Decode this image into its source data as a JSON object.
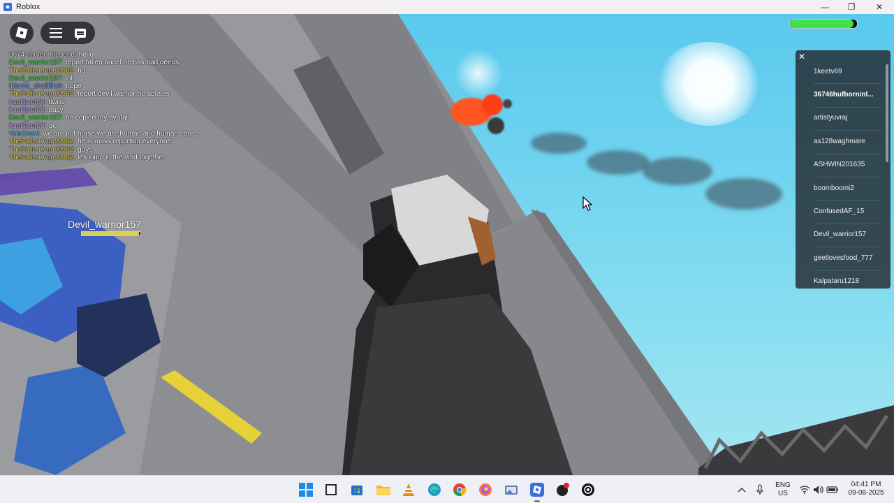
{
  "window": {
    "title": "Roblox",
    "icon": "roblox-icon",
    "controls": [
      "minimize",
      "restore",
      "close"
    ]
  },
  "hud": {
    "health_fraction": 0.95,
    "health_color": "#44e04a",
    "nametag": {
      "name": "Devil_warrior157",
      "health_fraction": 0.98
    }
  },
  "chat": {
    "lines": [
      {
        "user": "3674sfhufbornlegend:",
        "text": "hello",
        "color": "#d8d8d8"
      },
      {
        "user": "Devil_warrior157:",
        "text": "report fallen angel he has bad deeds",
        "color": "#4ee04e"
      },
      {
        "user": "TheFallenAngel0982:",
        "text": "no",
        "color": "#e0d060"
      },
      {
        "user": "Devil_warrior157:",
        "text": "lol",
        "color": "#4ee04e"
      },
      {
        "user": "iblame_shalllllluh:",
        "text": "nope",
        "color": "#6ea8ff"
      },
      {
        "user": "TheFallenAngel0982:",
        "text": "report devil warrior he abuses",
        "color": "#e0d060"
      },
      {
        "user": "kautilya408:",
        "text": "tiwns",
        "color": "#c9a3ff"
      },
      {
        "user": "kautilya408:",
        "text": "easy",
        "color": "#c9a3ff"
      },
      {
        "user": "Devil_warrior157:",
        "text": "he copied my avatar",
        "color": "#4ee04e"
      },
      {
        "user": "kautilya408:",
        "text": "ok",
        "color": "#c9a3ff"
      },
      {
        "user": "Vaishnavi:",
        "text": "we are not horse we are human and humans are...",
        "color": "#5fc0ff"
      },
      {
        "user": "TheFallenAngel0982:",
        "text": "he is mass reporting everyone",
        "color": "#e0d060"
      },
      {
        "user": "TheFallenAngel0982:",
        "text": "guys",
        "color": "#e0d060"
      },
      {
        "user": "TheFallenAngel0982:",
        "text": "les jump in the void together",
        "color": "#e0d060"
      }
    ]
  },
  "player_list": {
    "players": [
      {
        "name": "1keetv69",
        "bold": false
      },
      {
        "name": "36746hufborninl...",
        "bold": true
      },
      {
        "name": "artistyuvraj",
        "bold": false
      },
      {
        "name": "as128waghmare",
        "bold": false
      },
      {
        "name": "ASHWIN201635",
        "bold": false
      },
      {
        "name": "boomboomi2",
        "bold": false
      },
      {
        "name": "ConfusedAF_15",
        "bold": false
      },
      {
        "name": "Devil_warrior157",
        "bold": false
      },
      {
        "name": "geetlovesfood_777",
        "bold": false
      },
      {
        "name": "Kalpataru1218",
        "bold": false
      }
    ]
  },
  "taskbar": {
    "apps": [
      "windows-start-icon",
      "file-explorer-icon",
      "microsoft-store-icon",
      "folder-icon",
      "vlc-icon",
      "edge-icon",
      "chrome-icon",
      "firefox-icon",
      "photos-icon",
      "roblox-icon",
      "app-icon",
      "chatgpt-icon"
    ],
    "language": "ENG",
    "region": "US",
    "time": "04:41 PM",
    "date": "09-08-2025"
  }
}
